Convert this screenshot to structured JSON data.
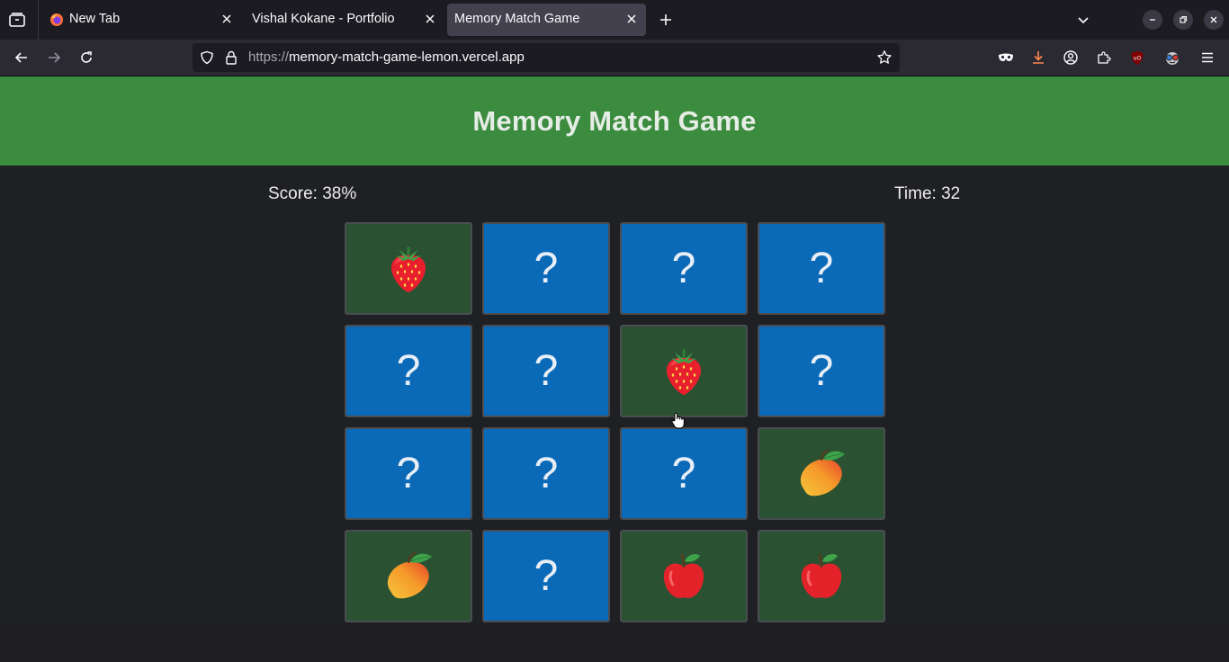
{
  "browser": {
    "tabs": [
      {
        "title": "New Tab",
        "active": false
      },
      {
        "title": "Vishal Kokane - Portfolio",
        "active": false
      },
      {
        "title": "Memory Match Game",
        "active": true
      }
    ],
    "url_scheme": "https://",
    "url_host": "memory-match-game-lemon.vercel.app"
  },
  "page": {
    "title": "Memory Match Game",
    "score_text": "Score: 38%",
    "time_text": "Time: 32",
    "hidden_symbol": "?"
  },
  "cards": [
    {
      "state": "revealed",
      "fruit": "strawberry"
    },
    {
      "state": "hidden"
    },
    {
      "state": "hidden"
    },
    {
      "state": "hidden"
    },
    {
      "state": "hidden"
    },
    {
      "state": "hidden"
    },
    {
      "state": "revealed",
      "fruit": "strawberry"
    },
    {
      "state": "hidden"
    },
    {
      "state": "hidden"
    },
    {
      "state": "hidden"
    },
    {
      "state": "hidden"
    },
    {
      "state": "revealed",
      "fruit": "mango"
    },
    {
      "state": "revealed",
      "fruit": "mango"
    },
    {
      "state": "hidden"
    },
    {
      "state": "revealed",
      "fruit": "apple"
    },
    {
      "state": "revealed",
      "fruit": "apple"
    }
  ],
  "colors": {
    "header_green": "#3c8c3f",
    "card_hidden": "#0b6ab8",
    "card_revealed": "#2a5232"
  }
}
